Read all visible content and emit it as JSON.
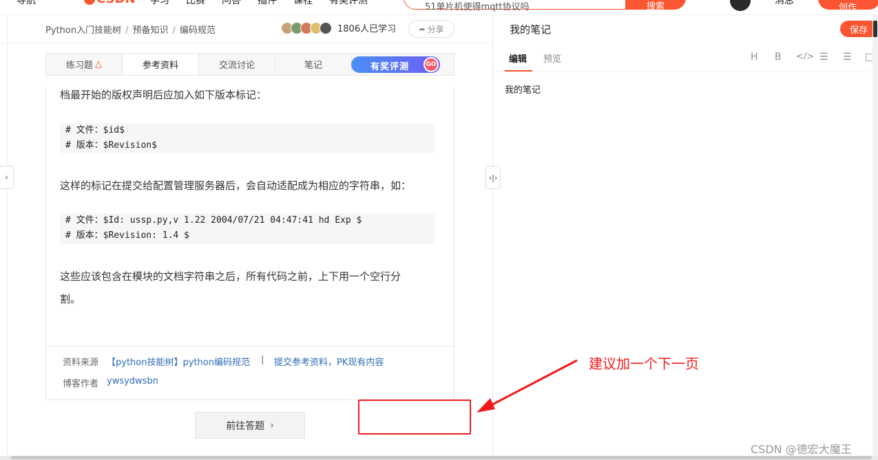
{
  "top_nav": {
    "items": [
      "导航",
      "学习",
      "比赛",
      "问答",
      "插件",
      "课程",
      "有奖评测"
    ],
    "logo": "CSDN",
    "search_text": "51单片机使得mqtt协议吗",
    "search_button": "搜索",
    "messages": "消息",
    "create_button": "创作"
  },
  "breadcrumb": {
    "items": [
      "Python入门技能树",
      "预备知识",
      "编码规范"
    ],
    "separator": "/"
  },
  "learners": {
    "count_text": "1806人已学习",
    "avatar_colors": [
      "#c9a27a",
      "#7a9a6b",
      "#d07a5a",
      "#e0c070",
      "#555555"
    ]
  },
  "share_button": "分享",
  "tabs": [
    {
      "label": "练习题",
      "icon": "flame-icon"
    },
    {
      "label": "参考资料"
    },
    {
      "label": "交流讨论"
    },
    {
      "label": "笔记"
    }
  ],
  "reward_banner": {
    "label": "有奖评测",
    "go": "GO"
  },
  "content": {
    "para1": "档最开始的版权声明后应加入如下版本标记：",
    "code1": [
      "# 文件：$id$",
      "# 版本：$Revision$"
    ],
    "para2": "这样的标记在提交给配置管理服务器后，会自动适配成为相应的字符串，如：",
    "code2": [
      "# 文件：$Id: ussp.py,v 1.22 2004/07/21 04:47:41 hd Exp $",
      "# 版本：$Revision: 1.4 $"
    ],
    "para3_line1": "这些应该包含在模块的文档字符串之后，所有代码之前，上下用一个空行分",
    "para3_line2": "割。"
  },
  "source": {
    "source_label": "资料来源",
    "source_link": "【python技能树】python编码规范",
    "divider": "|",
    "submit_link": "提交参考资料，PK现有内容",
    "author_label": "博客作者",
    "author_name": "ywsydwsbn"
  },
  "next_button": "前往答题",
  "notes": {
    "title": "我的笔记",
    "save_button": "保存",
    "tab_edit": "编辑",
    "tab_preview": "预览",
    "toolbar": [
      "H",
      "B",
      "</>",
      "bulleted-list",
      "numbered-list",
      "image"
    ],
    "body": "我的笔记"
  },
  "annotation": {
    "text": "建议加一个下一页",
    "color": "#f01a1a"
  },
  "watermark": "CSDN @德宏大魔王",
  "colors": {
    "brand": "#fc5531",
    "link": "#2e6bb6",
    "annotation": "#f01a1a"
  }
}
